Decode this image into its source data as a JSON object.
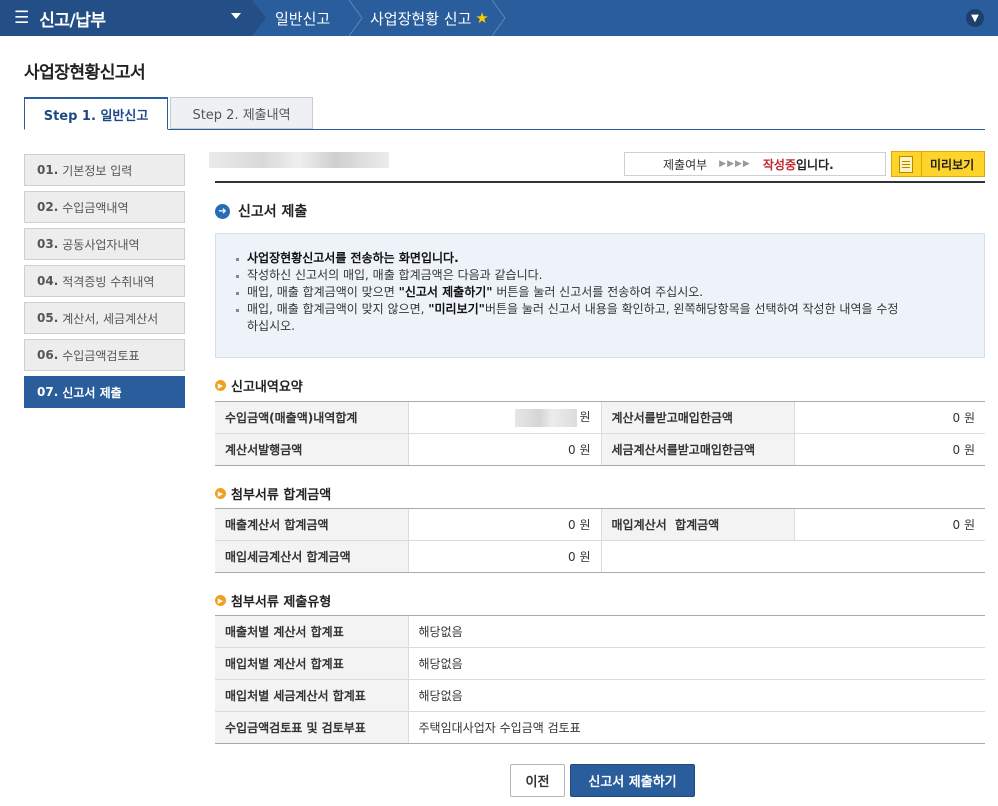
{
  "nav": {
    "menu_title": "신고/납부",
    "crumb1": "일반신고",
    "crumb2": "사업장현황 신고"
  },
  "page_title": "사업장현황신고서",
  "tabs": {
    "step1": "Step 1. 일반신고",
    "step2": "Step 2. 제출내역"
  },
  "side": [
    {
      "num": "01.",
      "label": "기본정보 입력"
    },
    {
      "num": "02.",
      "label": "수입금액내역"
    },
    {
      "num": "03.",
      "label": "공동사업자내역"
    },
    {
      "num": "04.",
      "label": "적격증빙 수취내역"
    },
    {
      "num": "05.",
      "label": "계산서, 세금계산서"
    },
    {
      "num": "06.",
      "label": "수입금액검토표"
    },
    {
      "num": "07.",
      "label": "신고서 제출"
    }
  ],
  "status": {
    "label": "제출여부",
    "arrows": "▶▶▶▶",
    "value_red": "작성중",
    "value_rest": "입니다."
  },
  "preview_label": "미리보기",
  "section_title": "신고서 제출",
  "notice": {
    "line1": "사업장현황신고서를 전송하는 화면입니다.",
    "line2": "작성하신 신고서의 매입, 매출 합계금액은 다음과 같습니다.",
    "line3_a": "매입, 매출 합계금액이 맞으면 ",
    "line3_b": "\"신고서 제출하기\"",
    "line3_c": " 버튼을 눌러 신고서를 전송하여 주십시오.",
    "line4_a": "매입, 매출 합계금액이 맞지 않으면, ",
    "line4_b": "\"미리보기\"",
    "line4_c": "버튼을 눌러 신고서 내용을 확인하고, 왼쪽해당항목을 선택하여 작성한 내역을 수정",
    "line4_d": "하십시오."
  },
  "summary": {
    "title": "신고내역요약",
    "r1_l": "수입금액(매출액)내역합계",
    "r1_lv": "원",
    "r1_r": "계산서를받고매입한금액",
    "r1_rv": "0 원",
    "r2_l": "계산서발행금액",
    "r2_lv": "0 원",
    "r2_r": "세금계산서를받고매입한금액",
    "r2_rv": "0 원"
  },
  "attach_sum": {
    "title": "첨부서류 합계금액",
    "r1_l": "매출계산서 합계금액",
    "r1_lv": "0 원",
    "r1_r": "매입계산서  합계금액",
    "r1_rv": "0 원",
    "r2_l": "매입세금계산서 합계금액",
    "r2_lv": "0 원"
  },
  "attach_type": {
    "title": "첨부서류 제출유형",
    "rows": [
      {
        "label": "매출처별 계산서 합계표",
        "value": "해당없음"
      },
      {
        "label": "매입처별 계산서 합계표",
        "value": "해당없음"
      },
      {
        "label": "매입처별 세금계산서 합계표",
        "value": "해당없음"
      },
      {
        "label": "수입금액검토표 및 검토부표",
        "value": "주택임대사업자 수입금액 검토표"
      }
    ]
  },
  "buttons": {
    "prev": "이전",
    "submit": "신고서 제출하기"
  },
  "colors": {
    "nav": "#2a5d9c",
    "preview": "#ffd42a",
    "status_red": "#c0282d"
  }
}
